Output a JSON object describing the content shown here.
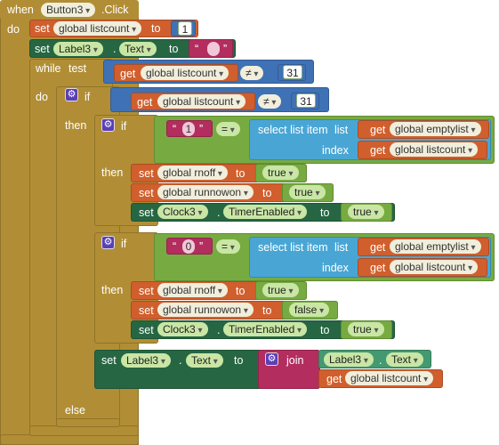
{
  "event": {
    "when": "when",
    "component": "Button3",
    "event_name": ".Click",
    "do": "do"
  },
  "kw": {
    "set": "set",
    "get": "get",
    "to": "to",
    "while": "while",
    "test": "test",
    "do": "do",
    "if": "if",
    "then": "then",
    "else": "else",
    "dot": ".",
    "join": "join",
    "select_list_item": "select list item",
    "list": "list",
    "index": "index",
    "neq": "≠",
    "eq": "=",
    "open_quote": "“",
    "close_quote": "”"
  },
  "vars": {
    "listcount": "global listcount",
    "emptylist": "global emptylist",
    "rnoff": "global rnoff",
    "runnowon": "global runnowon"
  },
  "components": {
    "label": "Label3",
    "label_prop": "Text",
    "clock": "Clock3",
    "clock_prop": "TimerEnabled"
  },
  "values": {
    "one": "1",
    "thirtyone": "31",
    "true": "true",
    "false": "false",
    "str_one": "1",
    "str_zero": "0",
    "empty_str": ""
  },
  "colors": {
    "event": "#b18e35",
    "control": "#b18e35",
    "variable": "#d05f2d",
    "component_set": "#266643",
    "component_get": "#439970",
    "logic": "#77ab41",
    "math": "#3f71b5",
    "text": "#b32d5e",
    "list": "#49a6d4"
  },
  "icons": {
    "gear": "gear-icon"
  }
}
